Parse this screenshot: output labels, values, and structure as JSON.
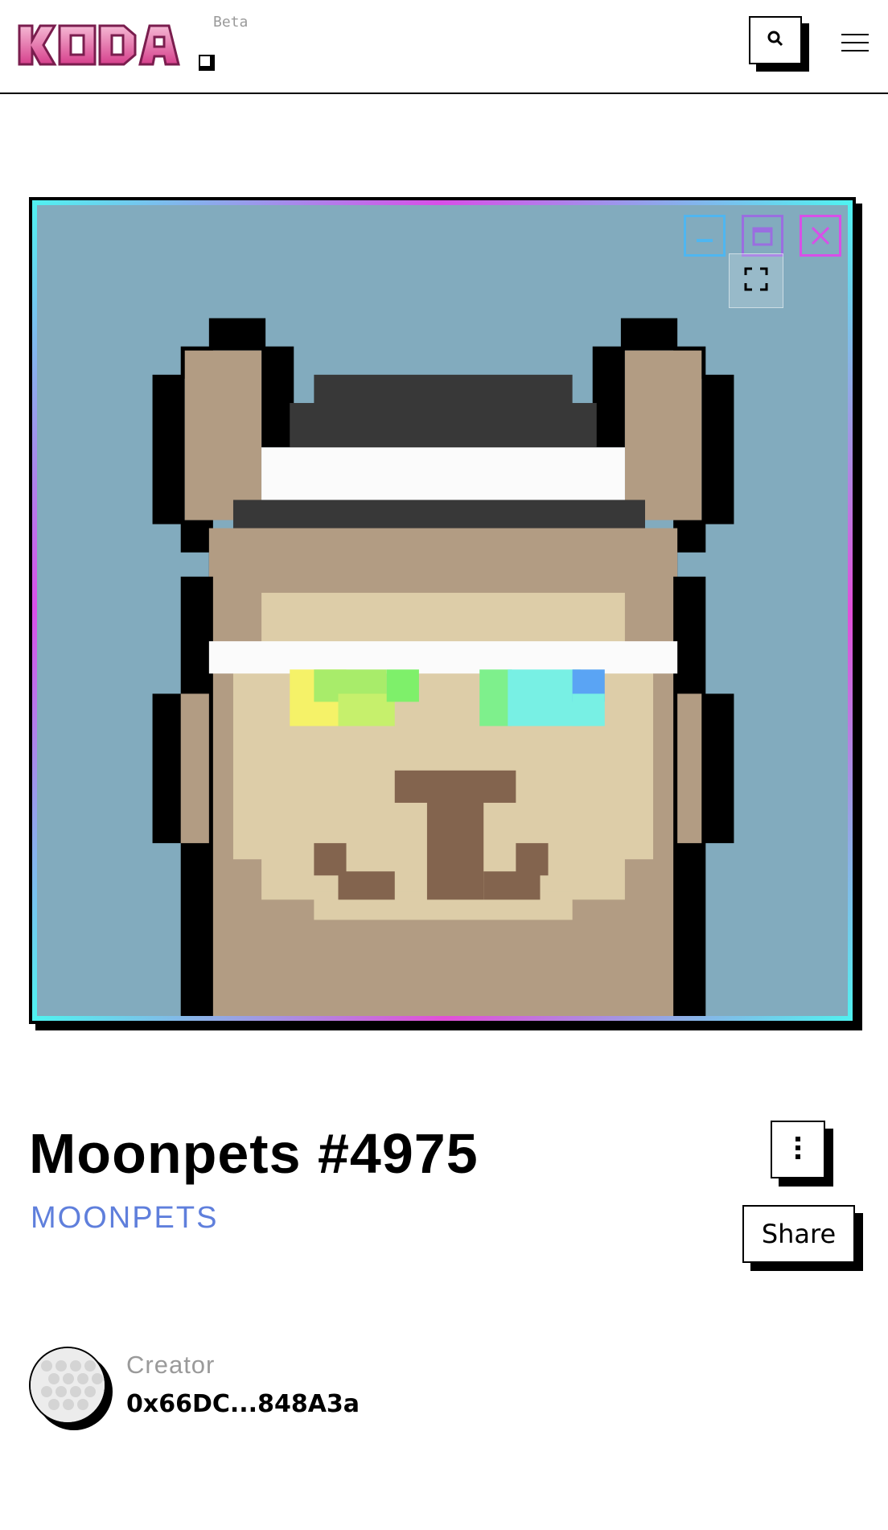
{
  "header": {
    "logo_text": "KODA",
    "beta_label": "Beta",
    "search_icon": "search-icon",
    "menu_icon": "hamburger-menu-icon"
  },
  "artwork": {
    "background_color": "#82abbe",
    "window_controls": [
      "minimize-icon",
      "maximize-icon",
      "close-icon"
    ],
    "fullscreen_icon": "fullscreen-icon"
  },
  "nft": {
    "title": "Moonpets #4975",
    "collection": "MOONPETS",
    "more_icon": "more-vertical-icon",
    "share_label": "Share"
  },
  "creator": {
    "label": "Creator",
    "address": "0x66DC...848A3a"
  },
  "colors": {
    "accent_blue": "#5f7fdc",
    "logo_pink": "#d6408c",
    "frame_cyan": "#4ff2f0",
    "frame_magenta": "#d84fe8"
  }
}
